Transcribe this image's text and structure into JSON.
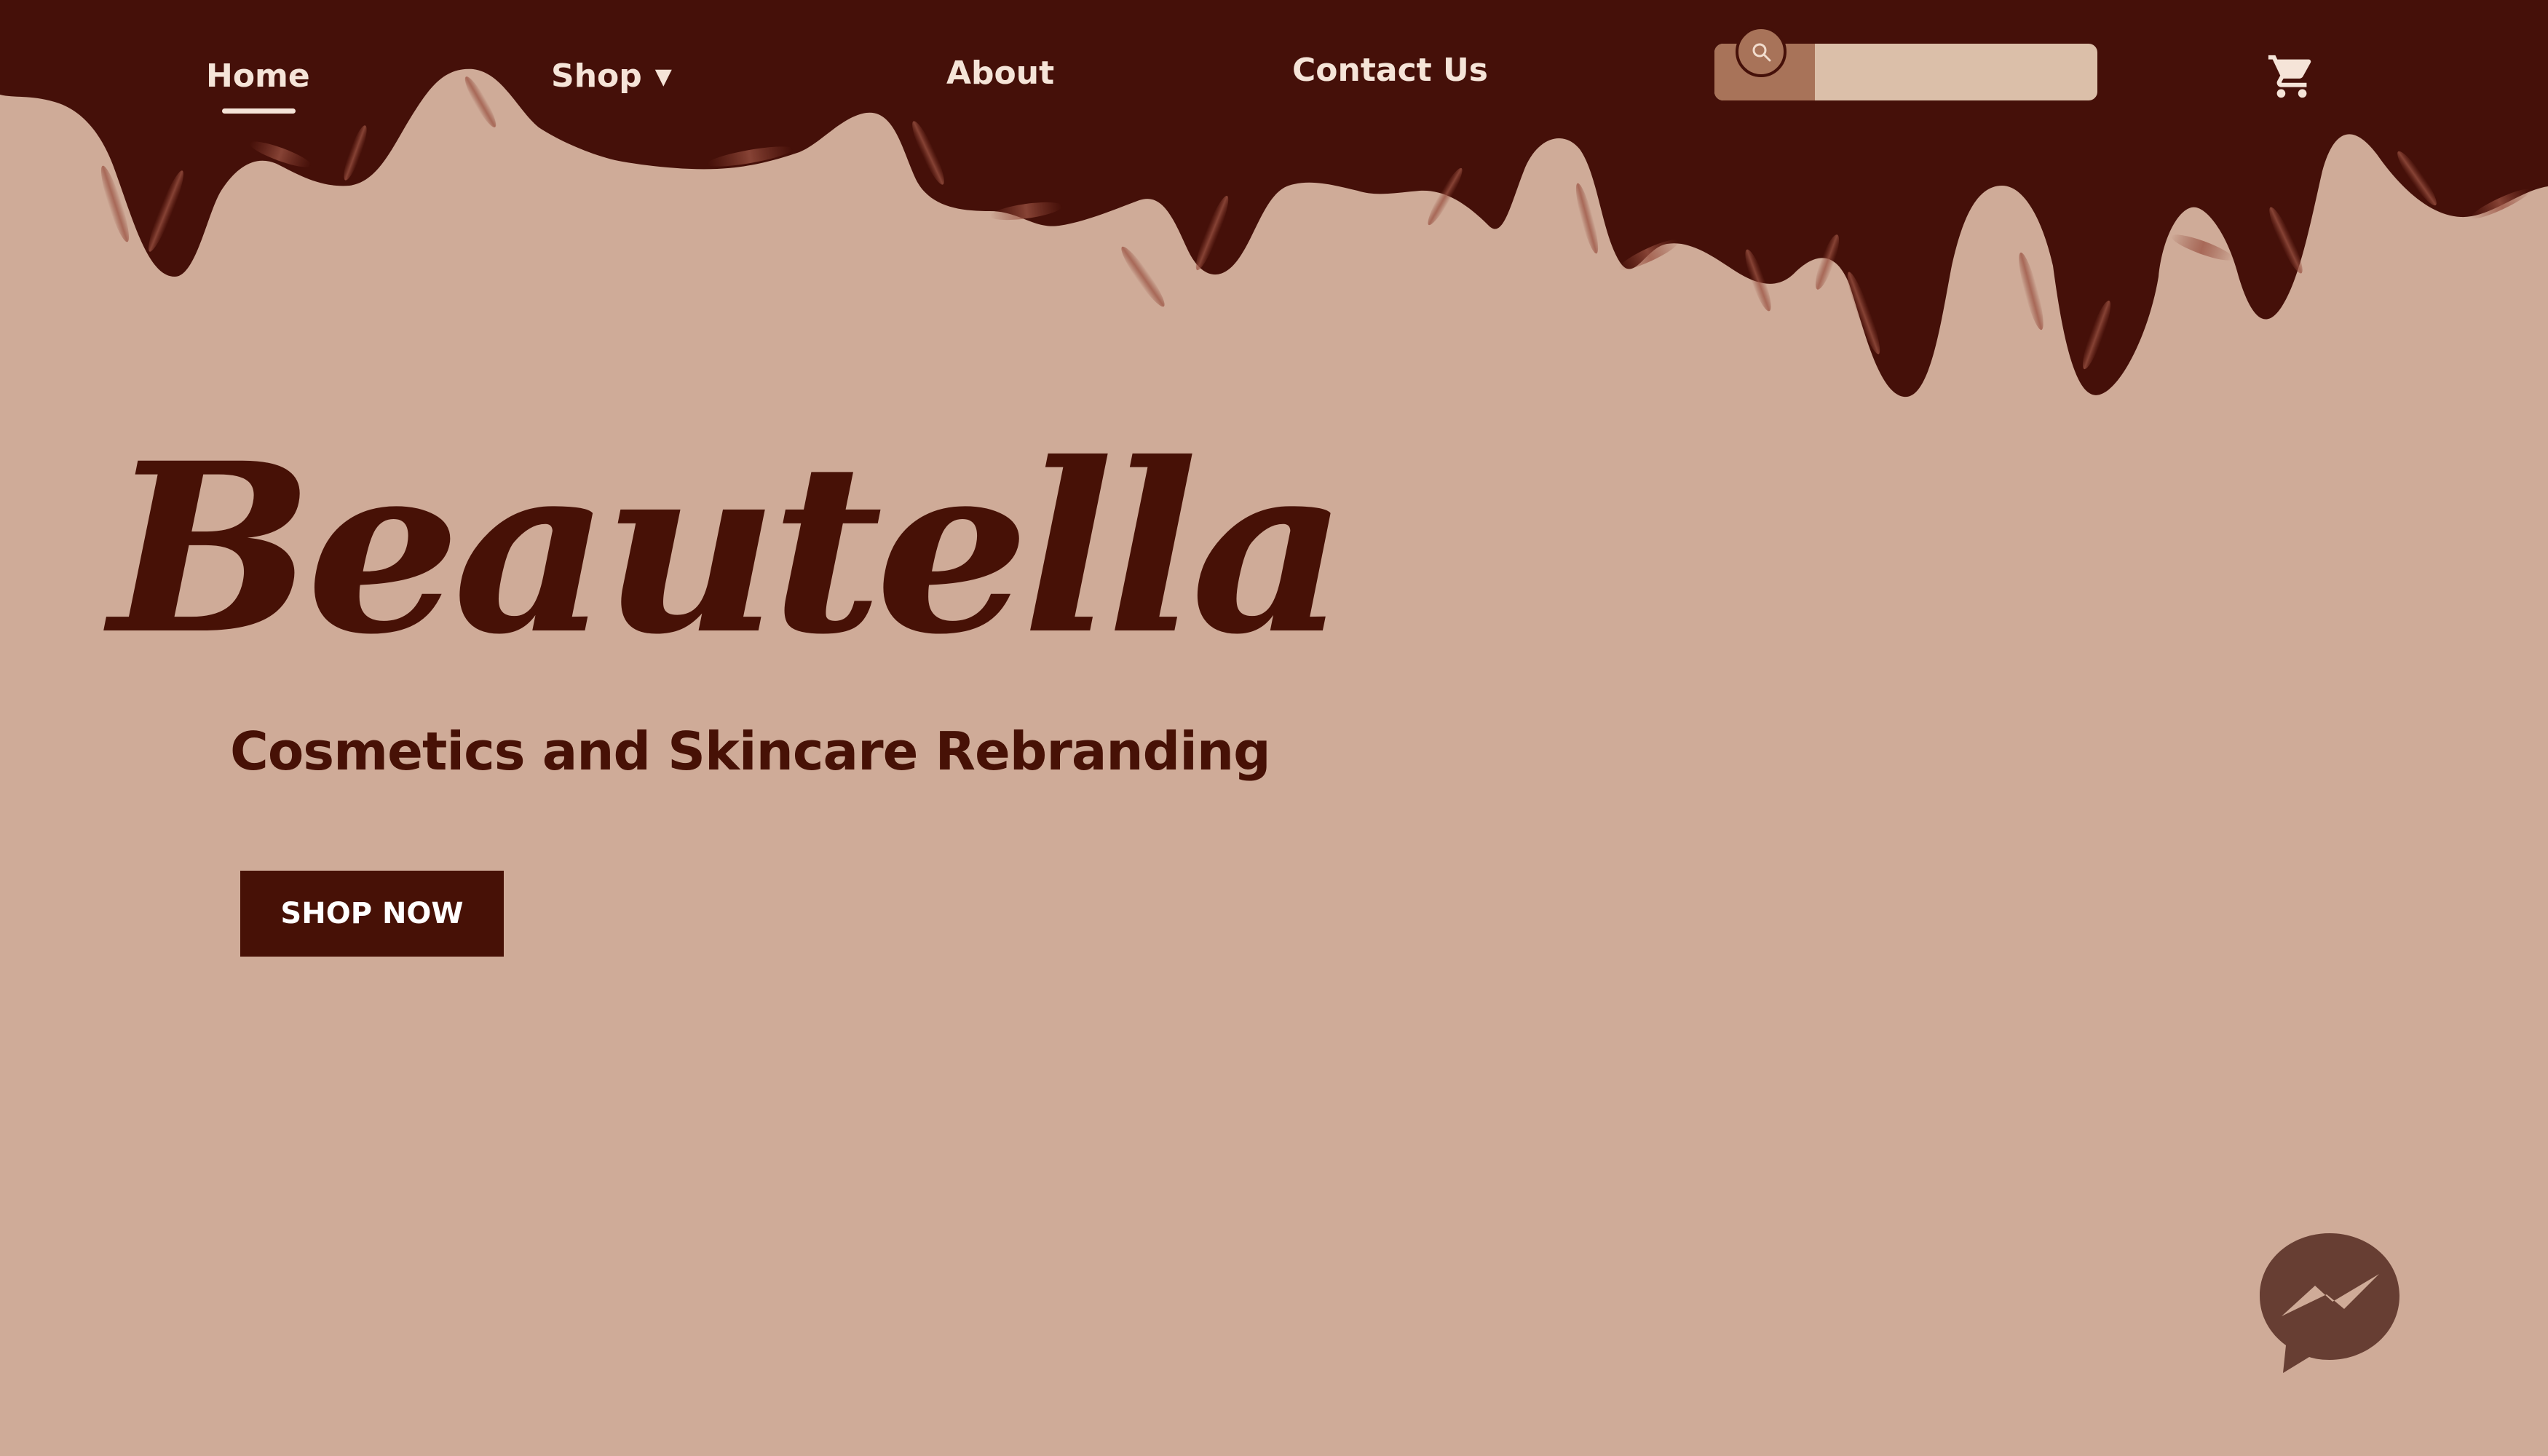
{
  "colors": {
    "background": "#cfab98",
    "chocolate": "#451009",
    "nav_text": "#f5e4d8",
    "search_field": "#dbbfa9",
    "search_accent": "#a87359",
    "button": "#471106",
    "messenger": "#673e33"
  },
  "nav": {
    "items": [
      {
        "label": "Home",
        "active": true
      },
      {
        "label": "Shop",
        "has_dropdown": true,
        "dropdown_icon": "caret-down-icon"
      },
      {
        "label": "About"
      },
      {
        "label": "Contact Us"
      }
    ]
  },
  "search": {
    "value": "",
    "placeholder": "",
    "icon": "search-icon"
  },
  "cart": {
    "icon": "shopping-cart-icon"
  },
  "hero": {
    "logo": "Beautella",
    "subtitle": "Cosmetics and Skincare Rebranding",
    "cta_label": "SHOP NOW"
  },
  "chat": {
    "icon": "messenger-icon"
  }
}
